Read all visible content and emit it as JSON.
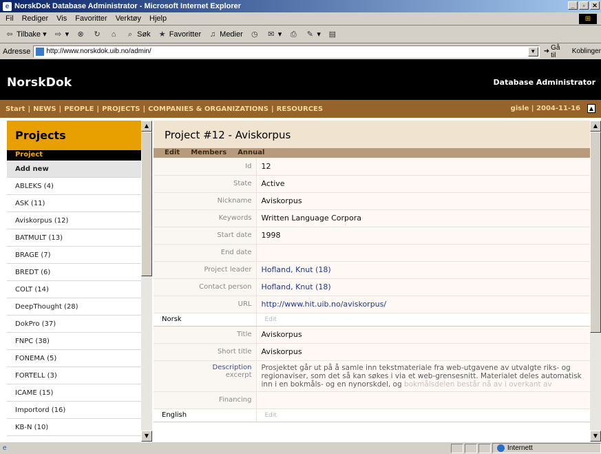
{
  "window": {
    "title": "NorskDok Database Administrator - Microsoft Internet Explorer"
  },
  "menu": [
    "Fil",
    "Rediger",
    "Vis",
    "Favoritter",
    "Verktøy",
    "Hjelp"
  ],
  "toolbar": {
    "back": "Tilbake",
    "search": "Søk",
    "favorites": "Favoritter",
    "media": "Medier"
  },
  "address": {
    "label": "Adresse",
    "url": "http://www.norskdok.uib.no/admin/",
    "go": "Gå til",
    "links": "Koblinger"
  },
  "site": {
    "logo": "NorskDok",
    "subtitle": "Database Administrator",
    "nav": [
      "Start",
      "NEWS",
      "PEOPLE",
      "PROJECTS",
      "COMPANIES & ORGANIZATIONS",
      "RESOURCES"
    ],
    "user": "gisle | 2004-11-16"
  },
  "sidebar": {
    "title": "Projects",
    "subtitle": "Project",
    "add_new": "Add new",
    "items": [
      "ABLEKS (4)",
      "ASK (11)",
      "Aviskorpus (12)",
      "BATMULT (13)",
      "BRAGE (7)",
      "BREDT (6)",
      "COLT (14)",
      "DeepThought (28)",
      "DokPro (37)",
      "FNPC (38)",
      "FONEMA (5)",
      "FORTELL (3)",
      "ICAME (15)",
      "Importord (16)",
      "KB-N (10)"
    ]
  },
  "project": {
    "title": "Project #12 - Aviskorpus",
    "tabs": [
      "Edit",
      "Members",
      "Annual"
    ],
    "fields": [
      {
        "label": "Id",
        "value": "12"
      },
      {
        "label": "State",
        "value": "Active"
      },
      {
        "label": "Nickname",
        "value": "Aviskorpus"
      },
      {
        "label": "Keywords",
        "value": "Written Language Corpora"
      },
      {
        "label": "Start date",
        "value": "1998"
      },
      {
        "label": "End date",
        "value": ""
      },
      {
        "label": "Project leader",
        "value": "Hofland, Knut (18)"
      },
      {
        "label": "Contact person",
        "value": "Hofland, Knut (18)"
      },
      {
        "label": "URL",
        "value": "http://www.hit.uib.no/aviskorpus/"
      }
    ],
    "norsk": {
      "section": "Norsk",
      "edit": "Edit",
      "title_label": "Title",
      "title": "Aviskorpus",
      "short_title_label": "Short title",
      "short_title": "Aviskorpus",
      "description_label": "Description",
      "description_sub": "excerpt",
      "description": "Prosjektet går ut på å samle inn tekstmateriale fra web-utgavene av utvalgte riks- og regionaviser, som det så kan søkes i via et web-grensesnitt. Materialet deles automatisk inn i en bokmåls- og en nynorskdel, og",
      "description_faded": "bokmålsdelen består nå av i overkant av",
      "financing_label": "Financing",
      "financing": ""
    },
    "english": {
      "section": "English",
      "edit": "Edit"
    }
  },
  "status": {
    "zone": "Internett"
  }
}
